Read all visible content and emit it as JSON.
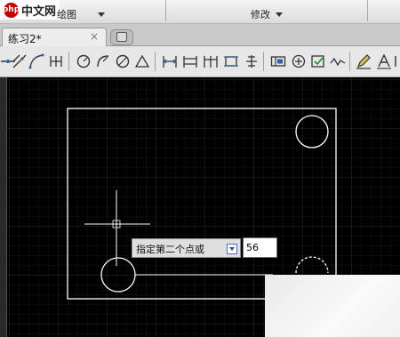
{
  "watermark": {
    "logo": "php",
    "text": "中文网"
  },
  "ribbon": {
    "groups": [
      {
        "label": "绘图"
      },
      {
        "label": "修改"
      }
    ]
  },
  "document_tab": {
    "label": "练习2*",
    "close": "×"
  },
  "prompt": {
    "text": "指定第二个点或",
    "value": "56"
  },
  "colors": {
    "canvas": "#000000",
    "geometry": "#ffffff",
    "crosshair": "#ffffff"
  }
}
